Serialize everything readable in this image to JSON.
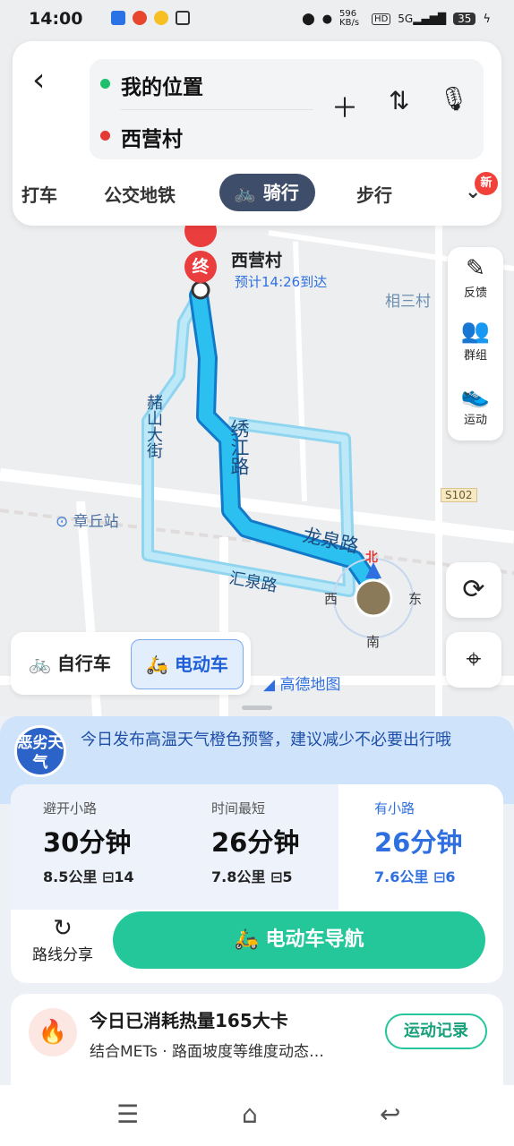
{
  "status_bar": {
    "time": "14:00",
    "speed": "596 KB/s",
    "battery": "35"
  },
  "search": {
    "origin": "我的位置",
    "destination": "西营村",
    "origin_color": "#1fbf6b",
    "destination_color": "#e53935"
  },
  "transport_tabs": [
    {
      "label": "打车"
    },
    {
      "label": "公交地铁"
    },
    {
      "label": "骑行",
      "active": true
    },
    {
      "label": "步行"
    }
  ],
  "new_badge": "新",
  "map": {
    "destination_marker": "终",
    "destination_name": "西营村",
    "eta": "预计14:26到达",
    "places": [
      "相三村",
      "章丘站",
      "S102"
    ],
    "roads": [
      "绣江路",
      "龙泉路",
      "汇泉路",
      "赭山大街"
    ],
    "compass": {
      "north": "北",
      "south": "南",
      "east": "东",
      "west": "西"
    },
    "brand": "高德地图"
  },
  "side_tools": [
    {
      "label": "反馈",
      "icon": "feedback-icon"
    },
    {
      "label": "群组",
      "icon": "group-icon"
    },
    {
      "label": "运动",
      "icon": "sport-icon"
    }
  ],
  "vehicle": {
    "bike": "自行车",
    "ebike": "电动车"
  },
  "weather": {
    "badge": "恶劣天气",
    "text": "今日发布高温天气橙色预警，建议减少不必要出行哦"
  },
  "routes": [
    {
      "label": "避开小路",
      "time": "30分钟",
      "distance": "8.5公里",
      "lights": "14"
    },
    {
      "label": "时间最短",
      "time": "26分钟",
      "distance": "7.8公里",
      "lights": "5"
    },
    {
      "label": "有小路",
      "time": "26分钟",
      "distance": "7.6公里",
      "lights": "6",
      "selected": true
    }
  ],
  "actions": {
    "share": "路线分享",
    "navigate": "电动车导航"
  },
  "calorie": {
    "title": "今日已消耗热量165大卡",
    "subtitle": "结合METs · 路面坡度等维度动态…",
    "button": "运动记录"
  },
  "colors": {
    "accent": "#2f6fe0",
    "green": "#24c79a",
    "route": "#2bb0ee"
  }
}
